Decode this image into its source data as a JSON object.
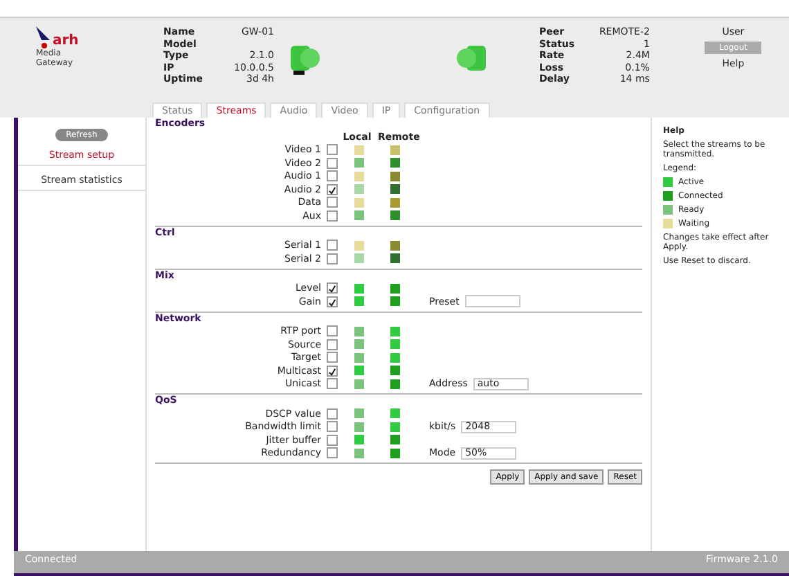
{
  "header": {
    "logo_text": "arh",
    "logo_sub": [
      "Media",
      "Gateway"
    ],
    "left_info": [
      {
        "label": "Name",
        "value": "GW-01"
      },
      {
        "label": "Model"
      },
      {
        "label": "Type",
        "value": "2.1.0"
      },
      {
        "label": "IP",
        "value": "10.0.0.5"
      },
      {
        "label": "Uptime",
        "value": "3d 4h"
      }
    ],
    "right_info": [
      {
        "label": "Peer",
        "value": "REMOTE-2"
      },
      {
        "label": "Status",
        "value": "1"
      },
      {
        "label": "Rate",
        "value": "2.4M"
      },
      {
        "label": "Loss",
        "value": "0.1%"
      },
      {
        "label": "Delay",
        "value": "14 ms"
      }
    ],
    "user": {
      "label": "User",
      "button": "Logout",
      "link": "Help"
    }
  },
  "tabs": [
    {
      "label": "Status",
      "selected": false
    },
    {
      "label": "Streams",
      "selected": true
    },
    {
      "label": "Audio",
      "selected": false
    },
    {
      "label": "Video",
      "selected": false
    },
    {
      "label": "IP",
      "selected": false
    },
    {
      "label": "Configuration",
      "selected": false
    }
  ],
  "sidebar": {
    "button": "Refresh",
    "items": [
      {
        "label": "Stream setup",
        "selected": true
      },
      {
        "label": "Stream statistics",
        "selected": false
      }
    ]
  },
  "columns": [
    "Local",
    "Remote"
  ],
  "sections": [
    {
      "title": "Encoders",
      "rows": [
        {
          "label": "Video 1",
          "checked": false,
          "local": {
            "color": "#e8dc9a"
          },
          "remote": {
            "color": "#c8c06a"
          }
        },
        {
          "label": "Video 2",
          "checked": false,
          "local": {
            "color": "#7cc47c"
          },
          "remote": {
            "color": "#2f8f2f"
          }
        },
        {
          "label": "Audio 1",
          "checked": false,
          "local": {
            "color": "#e8dc9a"
          },
          "remote": {
            "color": "#8a8a30"
          }
        },
        {
          "label": "Audio 2",
          "checked": true,
          "local": {
            "color": "#a8d8a8"
          },
          "remote": {
            "color": "#2f6f2f"
          }
        },
        {
          "label": "Data",
          "checked": false,
          "local": {
            "color": "#e8dc9a"
          },
          "remote": {
            "color": "#a89a30"
          }
        },
        {
          "label": "Aux",
          "checked": false,
          "local": {
            "color": "#7cc47c"
          },
          "remote": {
            "color": "#2f8f2f"
          }
        }
      ]
    },
    {
      "title": "Ctrl",
      "rows": [
        {
          "label": "Serial 1",
          "checked": false,
          "local": {
            "color": "#e8dc9a"
          },
          "remote": {
            "color": "#8a8a30"
          }
        },
        {
          "label": "Serial 2",
          "checked": false,
          "local": {
            "color": "#a8d8a8"
          },
          "remote": {
            "color": "#2f6f2f"
          }
        }
      ]
    },
    {
      "title": "Mix",
      "rows": [
        {
          "label": "Level",
          "checked": true,
          "local": {
            "color": "#2ecc40"
          },
          "remote": {
            "color": "#1f9f1f"
          }
        },
        {
          "label": "Gain",
          "checked": true,
          "local": {
            "color": "#2ecc40"
          },
          "remote": {
            "color": "#1f9f1f"
          },
          "field_label": "Preset"
        }
      ]
    },
    {
      "title": "Network",
      "rows": [
        {
          "label": "RTP port",
          "checked": false,
          "local": {
            "color": "#7cc47c"
          },
          "remote": {
            "color": "#2ecc40"
          }
        },
        {
          "label": "Source",
          "checked": false,
          "local": {
            "color": "#7cc47c"
          },
          "remote": {
            "color": "#2ecc40"
          }
        },
        {
          "label": "Target",
          "checked": false,
          "local": {
            "color": "#7cc47c"
          },
          "remote": {
            "color": "#2ecc40"
          }
        },
        {
          "label": "Multicast",
          "checked": true,
          "local": {
            "color": "#2ecc40"
          },
          "remote": {
            "color": "#1f9f1f"
          }
        },
        {
          "label": "Unicast",
          "checked": false,
          "local": {
            "color": "#7cc47c"
          },
          "remote": {
            "color": "#1f9f1f"
          },
          "field_label": "Address",
          "field_value": "auto"
        }
      ]
    },
    {
      "title": "QoS",
      "rows": [
        {
          "label": "DSCP value",
          "checked": false,
          "local": {
            "color": "#7cc47c"
          },
          "remote": {
            "color": "#2ecc40"
          }
        },
        {
          "label": "Bandwidth limit",
          "checked": false,
          "local": {
            "color": "#7cc47c"
          },
          "remote": {
            "color": "#2ecc40"
          },
          "field_label": "kbit/s",
          "field_value": "2048"
        },
        {
          "label": "Jitter buffer",
          "checked": false,
          "local": {
            "color": "#2ecc40"
          },
          "remote": {
            "color": "#1f9f1f"
          }
        },
        {
          "label": "Redundancy",
          "checked": false,
          "local": {
            "color": "#7cc47c"
          },
          "remote": {
            "color": "#1f9f1f"
          },
          "field_label": "Mode",
          "field_value": "50%"
        }
      ]
    }
  ],
  "buttons": [
    "Apply",
    "Apply and save",
    "Reset"
  ],
  "help": {
    "title": "Help",
    "paragraphs": [
      "Select the streams to be transmitted.",
      "Legend:"
    ],
    "legend": [
      {
        "color": "#2ecc40",
        "text": "Active"
      },
      {
        "color": "#1f9f1f",
        "text": "Connected"
      },
      {
        "color": "#7cc47c",
        "text": "Ready"
      },
      {
        "color": "#e8dc9a",
        "text": "Waiting"
      }
    ],
    "notes": [
      "Changes take effect after Apply.",
      "Use Reset to discard."
    ]
  },
  "status_bar": {
    "left": "Connected",
    "right": "Firmware 2.1.0"
  }
}
